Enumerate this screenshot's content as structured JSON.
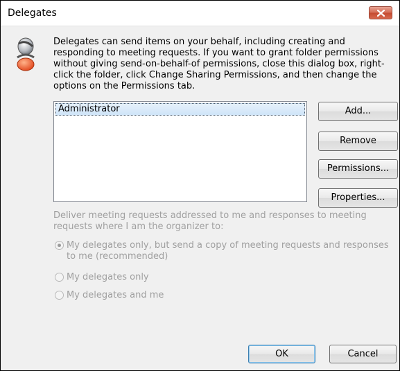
{
  "window": {
    "title": "Delegates"
  },
  "description": "Delegates can send items on your behalf, including creating and responding to meeting requests. If you want to grant folder permissions without giving send-on-behalf-of permissions, close this dialog box, right-click the folder, click Change Sharing Permissions, and then change the options on the Permissions tab.",
  "delegates": {
    "items": [
      "Administrator"
    ],
    "selected": "Administrator"
  },
  "buttons": {
    "add": "Add...",
    "remove": "Remove",
    "permissions": "Permissions...",
    "properties": "Properties...",
    "ok": "OK",
    "cancel": "Cancel"
  },
  "delivery": {
    "label": "Deliver meeting requests addressed to me and responses to meeting requests where I am the organizer to:",
    "options": [
      {
        "label": "My delegates only, but send a copy of meeting requests and responses to me (recommended)",
        "checked": true
      },
      {
        "label": "My delegates only",
        "checked": false
      },
      {
        "label": "My delegates and me",
        "checked": false
      }
    ],
    "enabled": false
  },
  "colors": {
    "disabled_text": "#a0a0a0",
    "selection": "#cfe4f8",
    "close": "#c44a30"
  }
}
